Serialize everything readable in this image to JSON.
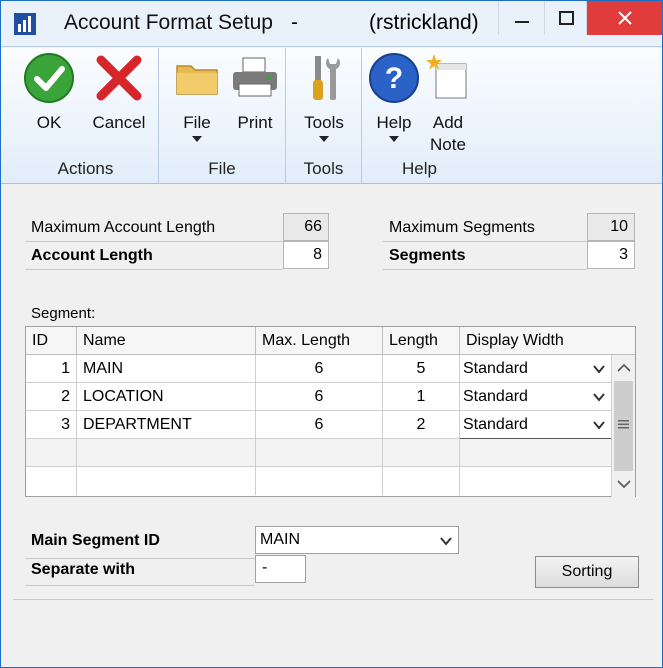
{
  "window": {
    "title": "Account Format Setup",
    "title_separator": "-",
    "user": "(rstrickland)"
  },
  "ribbon": {
    "groups": [
      {
        "label": "Actions",
        "buttons": [
          {
            "label": "OK",
            "icon": "check-icon"
          },
          {
            "label": "Cancel",
            "icon": "x-icon"
          }
        ]
      },
      {
        "label": "File",
        "buttons": [
          {
            "label": "File",
            "icon": "folder-icon"
          },
          {
            "label": "Print",
            "icon": "printer-icon"
          }
        ]
      },
      {
        "label": "Tools",
        "buttons": [
          {
            "label": "Tools",
            "icon": "tools-icon"
          }
        ]
      },
      {
        "label": "Help",
        "buttons": [
          {
            "label": "Help",
            "icon": "help-icon"
          },
          {
            "label": "Add",
            "label2": "Note",
            "icon": "note-icon"
          }
        ]
      }
    ]
  },
  "form": {
    "max_account_length_label": "Maximum Account Length",
    "max_account_length_value": "66",
    "account_length_label": "Account Length",
    "account_length_value": "8",
    "max_segments_label": "Maximum Segments",
    "max_segments_value": "10",
    "segments_label": "Segments",
    "segments_value": "3",
    "segment_label": "Segment:"
  },
  "grid": {
    "headers": [
      "ID",
      "Name",
      "Max. Length",
      "Length",
      "Display Width"
    ],
    "rows": [
      {
        "id": "1",
        "name": "MAIN",
        "max_length": "6",
        "length": "5",
        "display_width": "Standard"
      },
      {
        "id": "2",
        "name": "LOCATION",
        "max_length": "6",
        "length": "1",
        "display_width": "Standard"
      },
      {
        "id": "3",
        "name": "DEPARTMENT",
        "max_length": "6",
        "length": "2",
        "display_width": "Standard"
      }
    ]
  },
  "footer": {
    "main_segment_label": "Main Segment ID",
    "main_segment_value": "MAIN",
    "separate_label": "Separate with",
    "separate_value": "-",
    "sorting_button": "Sorting"
  },
  "colors": {
    "close_button": "#e13c3c",
    "ok_green": "#3aa33a",
    "cancel_red": "#d6262a",
    "help_blue": "#2a62c8"
  }
}
